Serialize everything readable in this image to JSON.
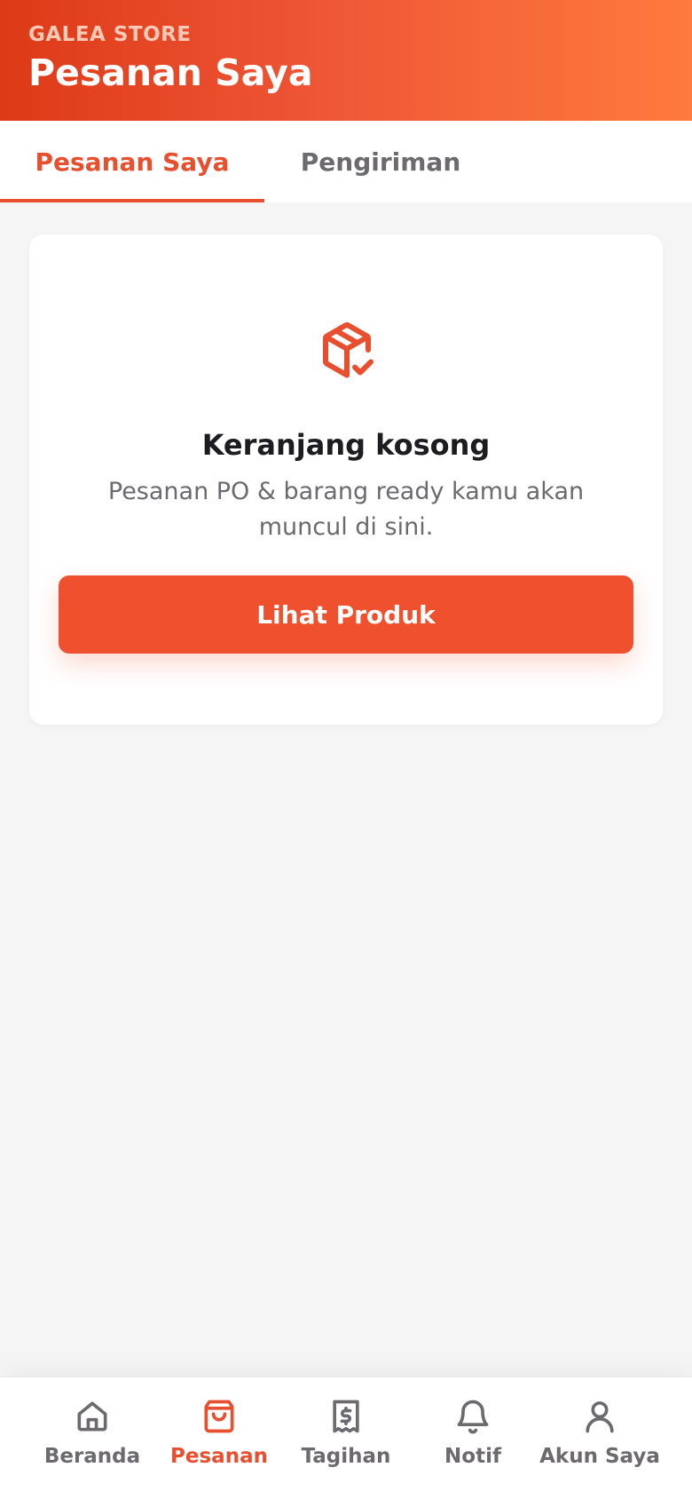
{
  "header": {
    "brand": "GALEA STORE",
    "title": "Pesanan Saya"
  },
  "tabs": [
    {
      "label": "Pesanan Saya",
      "active": true
    },
    {
      "label": "Pengiriman",
      "active": false
    }
  ],
  "empty_state": {
    "icon": "package-check-icon",
    "title": "Keranjang kosong",
    "description": "Pesanan PO & barang ready kamu akan muncul di sini.",
    "button_label": "Lihat Produk"
  },
  "bottom_nav": [
    {
      "label": "Beranda",
      "icon": "home-icon",
      "active": false
    },
    {
      "label": "Pesanan",
      "icon": "shopping-bag-icon",
      "active": true
    },
    {
      "label": "Tagihan",
      "icon": "receipt-dollar-icon",
      "active": false
    },
    {
      "label": "Notif",
      "icon": "bell-icon",
      "active": false
    },
    {
      "label": "Akun Saya",
      "icon": "user-icon",
      "active": false
    }
  ],
  "colors": {
    "accent": "#e74f2f",
    "header_start": "#dd3a17",
    "header_end": "#ff7a3d",
    "inactive": "#6c6a6f",
    "background": "#f5f5f5"
  }
}
